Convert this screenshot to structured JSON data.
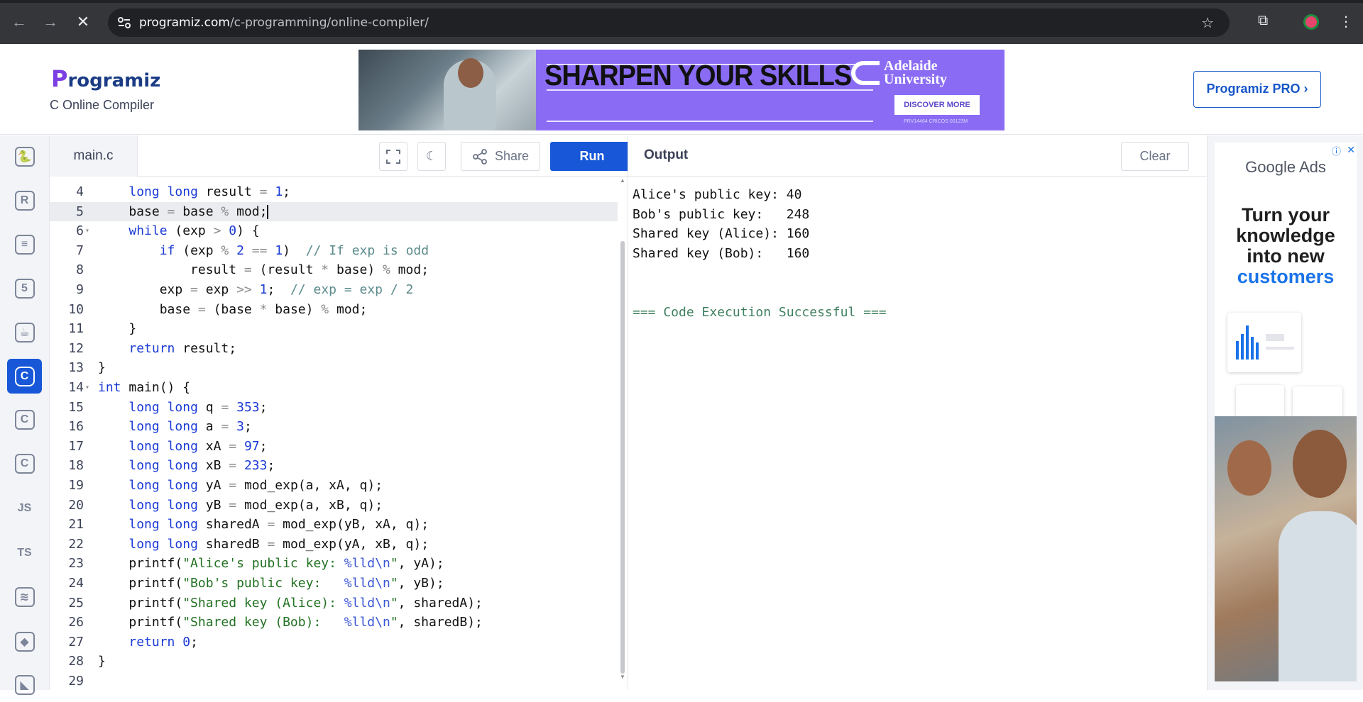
{
  "browser": {
    "url_host": "programiz.com",
    "url_path": "/c-programming/online-compiler/"
  },
  "header": {
    "logo_initial": "P",
    "logo_rest": "rogramiz",
    "subtitle": "C Online Compiler",
    "pro_button": "Programiz PRO ›",
    "ad": {
      "headline": "SHARPEN YOUR SKILLS",
      "university": "Adelaide\nUniversity",
      "cta": "DISCOVER MORE",
      "fine_print": "PRV14464 CRICOS 00123M"
    }
  },
  "sidebar": {
    "languages": [
      {
        "name": "python",
        "glyph": "🐍",
        "active": false
      },
      {
        "name": "r",
        "glyph": "R",
        "active": false
      },
      {
        "name": "sql",
        "glyph": "≡",
        "active": false
      },
      {
        "name": "html",
        "glyph": "5",
        "active": false
      },
      {
        "name": "java",
        "glyph": "☕",
        "active": false
      },
      {
        "name": "c",
        "glyph": "C",
        "active": true
      },
      {
        "name": "cpp",
        "glyph": "C",
        "active": false
      },
      {
        "name": "csharp",
        "glyph": "C",
        "active": false
      },
      {
        "name": "js",
        "glyph": "JS",
        "active": false
      },
      {
        "name": "ts",
        "glyph": "TS",
        "active": false
      },
      {
        "name": "go",
        "glyph": "≋",
        "active": false
      },
      {
        "name": "php",
        "glyph": "◆",
        "active": false
      },
      {
        "name": "swift",
        "glyph": "◣",
        "active": false
      }
    ]
  },
  "editor": {
    "filename": "main.c",
    "share_label": "Share",
    "run_label": "Run",
    "current_line": 5,
    "lines": [
      {
        "n": "4",
        "fold": "",
        "html": "    <span class='kw'>long</span> <span class='kw'>long</span> result <span class='op'>=</span> <span class='num'>1</span>;"
      },
      {
        "n": "5",
        "fold": "",
        "html": "    base <span class='op'>=</span> base <span class='op'>%</span> mod;<span class='caret'></span>"
      },
      {
        "n": "6",
        "fold": "▾",
        "html": "    <span class='kw'>while</span> (exp <span class='op'>&gt;</span> <span class='num'>0</span>) {"
      },
      {
        "n": "7",
        "fold": "",
        "html": "        <span class='kw'>if</span> (exp <span class='op'>%</span> <span class='num'>2</span> <span class='op'>==</span> <span class='num'>1</span>)  <span class='cm'>// If exp is odd</span>"
      },
      {
        "n": "8",
        "fold": "",
        "html": "            result <span class='op'>=</span> (result <span class='op'>*</span> base) <span class='op'>%</span> mod;"
      },
      {
        "n": "9",
        "fold": "",
        "html": "        exp <span class='op'>=</span> exp <span class='op'>&gt;&gt;</span> <span class='num'>1</span>;  <span class='cm'>// exp = exp / 2</span>"
      },
      {
        "n": "10",
        "fold": "",
        "html": "        base <span class='op'>=</span> (base <span class='op'>*</span> base) <span class='op'>%</span> mod;"
      },
      {
        "n": "11",
        "fold": "",
        "html": "    }"
      },
      {
        "n": "12",
        "fold": "",
        "html": "    <span class='kw'>return</span> result;"
      },
      {
        "n": "13",
        "fold": "",
        "html": "}"
      },
      {
        "n": "14",
        "fold": "▾",
        "html": "<span class='kw'>int</span> main() {"
      },
      {
        "n": "15",
        "fold": "",
        "html": "    <span class='kw'>long</span> <span class='kw'>long</span> q <span class='op'>=</span> <span class='num'>353</span>;"
      },
      {
        "n": "16",
        "fold": "",
        "html": "    <span class='kw'>long</span> <span class='kw'>long</span> a <span class='op'>=</span> <span class='num'>3</span>;"
      },
      {
        "n": "17",
        "fold": "",
        "html": "    <span class='kw'>long</span> <span class='kw'>long</span> xA <span class='op'>=</span> <span class='num'>97</span>;"
      },
      {
        "n": "18",
        "fold": "",
        "html": "    <span class='kw'>long</span> <span class='kw'>long</span> xB <span class='op'>=</span> <span class='num'>233</span>;"
      },
      {
        "n": "19",
        "fold": "",
        "html": "    <span class='kw'>long</span> <span class='kw'>long</span> yA <span class='op'>=</span> mod_exp(a, xA, q);"
      },
      {
        "n": "20",
        "fold": "",
        "html": "    <span class='kw'>long</span> <span class='kw'>long</span> yB <span class='op'>=</span> mod_exp(a, xB, q);"
      },
      {
        "n": "21",
        "fold": "",
        "html": "    <span class='kw'>long</span> <span class='kw'>long</span> sharedA <span class='op'>=</span> mod_exp(yB, xA, q);"
      },
      {
        "n": "22",
        "fold": "",
        "html": "    <span class='kw'>long</span> <span class='kw'>long</span> sharedB <span class='op'>=</span> mod_exp(yA, xB, q);"
      },
      {
        "n": "23",
        "fold": "",
        "html": "    printf(<span class='str'>\"Alice's public key: </span><span class='esc'>%lld\\n</span><span class='str'>\"</span>, yA);"
      },
      {
        "n": "24",
        "fold": "",
        "html": "    printf(<span class='str'>\"Bob's public key:   </span><span class='esc'>%lld\\n</span><span class='str'>\"</span>, yB);"
      },
      {
        "n": "25",
        "fold": "",
        "html": "    printf(<span class='str'>\"Shared key (Alice): </span><span class='esc'>%lld\\n</span><span class='str'>\"</span>, sharedA);"
      },
      {
        "n": "26",
        "fold": "",
        "html": "    printf(<span class='str'>\"Shared key (Bob):   </span><span class='esc'>%lld\\n</span><span class='str'>\"</span>, sharedB);"
      },
      {
        "n": "27",
        "fold": "",
        "html": "    <span class='kw'>return</span> <span class='num'>0</span>;"
      },
      {
        "n": "28",
        "fold": "",
        "html": "}"
      },
      {
        "n": "29",
        "fold": "",
        "html": ""
      }
    ]
  },
  "output": {
    "title": "Output",
    "clear_label": "Clear",
    "lines": [
      {
        "text": "Alice's public key: 40",
        "success": false
      },
      {
        "text": "Bob's public key:   248",
        "success": false
      },
      {
        "text": "Shared key (Alice): 160",
        "success": false
      },
      {
        "text": "Shared key (Bob):   160",
        "success": false
      },
      {
        "text": "",
        "success": false
      },
      {
        "text": "",
        "success": false
      },
      {
        "text": "=== Code Execution Successful ===",
        "success": true
      }
    ]
  },
  "right_ad": {
    "brand": "Google Ads",
    "text_lines": [
      "Turn your",
      "knowledge",
      "into new"
    ],
    "highlight": "customers"
  },
  "colors": {
    "primary": "#1757d8",
    "keyword": "#1a3ad6",
    "string": "#227122",
    "comment": "#5b8a8b"
  }
}
